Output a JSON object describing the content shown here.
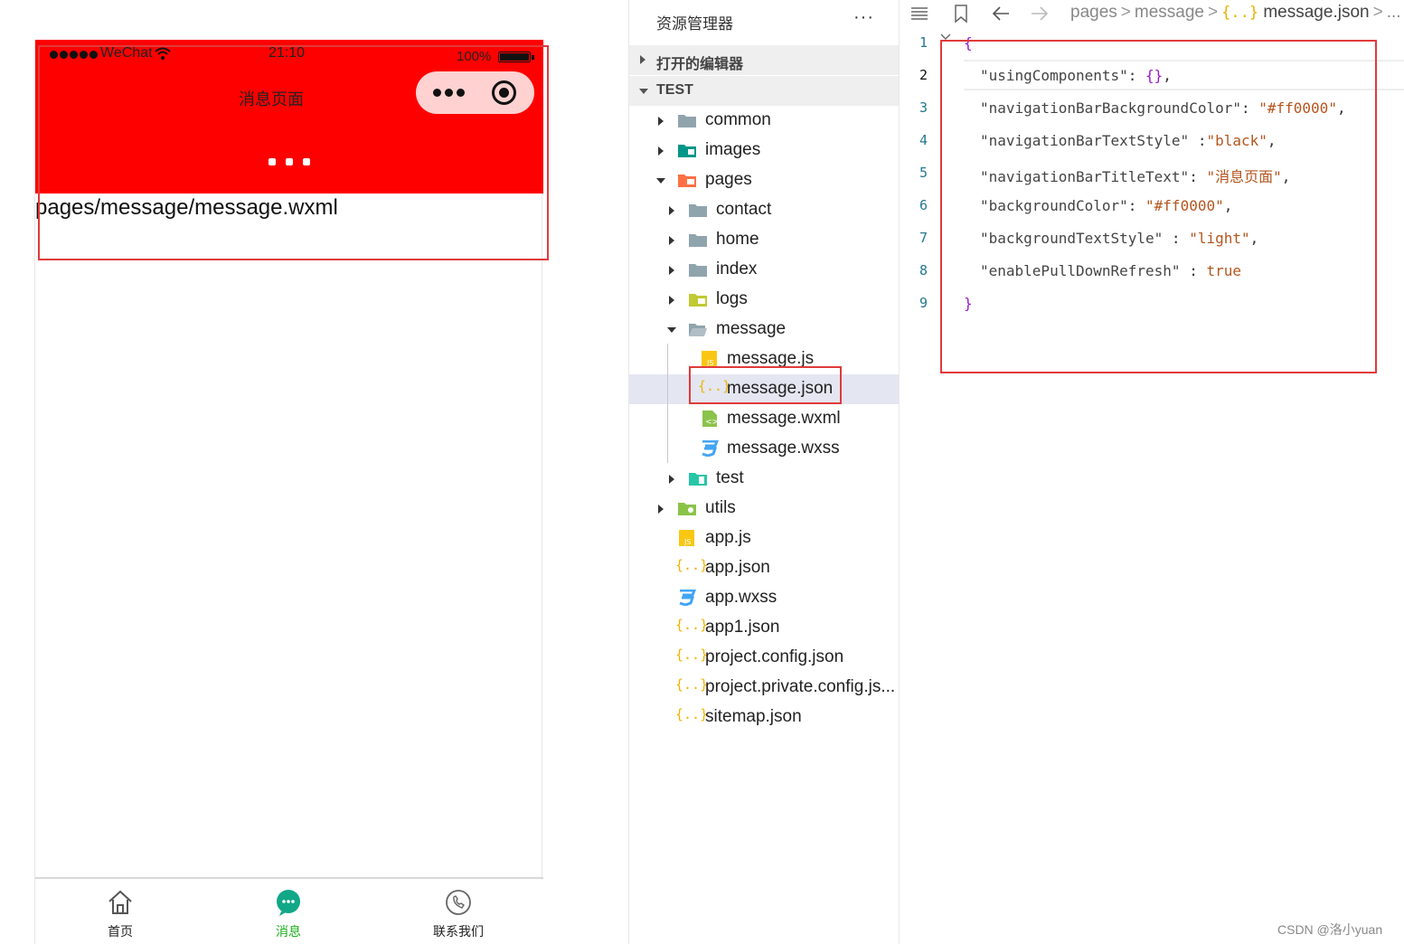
{
  "phone": {
    "status_bar": {
      "carrier": "WeChat",
      "time": "21:10",
      "battery": "100%"
    },
    "nav_title": "消息页面",
    "page_text": "pages/message/message.wxml",
    "tabs": [
      {
        "label": "首页",
        "icon": "home-icon",
        "active": false
      },
      {
        "label": "消息",
        "icon": "message-icon",
        "active": true
      },
      {
        "label": "联系我们",
        "icon": "phone-icon",
        "active": false
      }
    ],
    "colors": {
      "navbar": "#ff0000",
      "active_tab": "#1aad19"
    }
  },
  "explorer": {
    "title": "资源管理器",
    "more": "···",
    "open_editors_label": "打开的编辑器",
    "project_label": "TEST",
    "tree": [
      {
        "name": "common",
        "type": "folder"
      },
      {
        "name": "images",
        "type": "folder"
      },
      {
        "name": "pages",
        "type": "folder"
      },
      {
        "name": "contact",
        "type": "folder"
      },
      {
        "name": "home",
        "type": "folder"
      },
      {
        "name": "index",
        "type": "folder"
      },
      {
        "name": "logs",
        "type": "folder"
      },
      {
        "name": "message",
        "type": "folder"
      },
      {
        "name": "message.js",
        "type": "js"
      },
      {
        "name": "message.json",
        "type": "json",
        "selected": true
      },
      {
        "name": "message.wxml",
        "type": "wxml"
      },
      {
        "name": "message.wxss",
        "type": "wxss"
      },
      {
        "name": "test",
        "type": "folder"
      },
      {
        "name": "utils",
        "type": "folder"
      },
      {
        "name": "app.js",
        "type": "js"
      },
      {
        "name": "app.json",
        "type": "json"
      },
      {
        "name": "app.wxss",
        "type": "wxss"
      },
      {
        "name": "app1.json",
        "type": "json"
      },
      {
        "name": "project.config.json",
        "type": "json"
      },
      {
        "name": "project.private.config.js...",
        "type": "json"
      },
      {
        "name": "sitemap.json",
        "type": "json"
      }
    ]
  },
  "editor": {
    "breadcrumb": [
      "pages",
      "message",
      "message.json",
      "..."
    ],
    "line_numbers": [
      "1",
      "2",
      "3",
      "4",
      "5",
      "6",
      "7",
      "8",
      "9"
    ],
    "code": {
      "l1": "{",
      "l2_key": "\"usingComponents\"",
      "l2_val": "{}",
      "l3_key": "\"navigationBarBackgroundColor\"",
      "l3_val": "\"#ff0000\"",
      "l4_key": "\"navigationBarTextStyle\"",
      "l4_val": "\"black\"",
      "l5_key": "\"navigationBarTitleText\"",
      "l5_val": "\"消息页面\"",
      "l6_key": "\"backgroundColor\"",
      "l6_val": "\"#ff0000\"",
      "l7_key": "\"backgroundTextStyle\"",
      "l7_val": "\"light\"",
      "l8_key": "\"enablePullDownRefresh\"",
      "l8_val": "true",
      "l9": "}"
    }
  },
  "watermark": "CSDN @洛小yuan",
  "highlight_color": "#e03b3b"
}
